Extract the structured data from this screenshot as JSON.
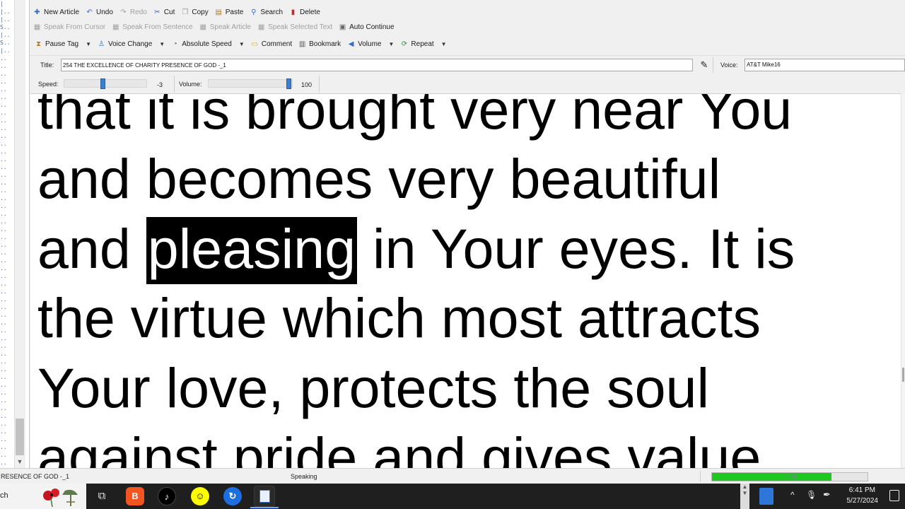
{
  "toolbar_main": {
    "new_article": "New Article",
    "undo": "Undo",
    "redo": "Redo",
    "cut": "Cut",
    "copy": "Copy",
    "paste": "Paste",
    "search": "Search",
    "delete": "Delete"
  },
  "toolbar_speak": {
    "speak_from_cursor": "Speak From Cursor",
    "speak_from_sentence": "Speak From Sentence",
    "speak_article": "Speak Article",
    "speak_selected_text": "Speak Selected Text",
    "auto_continue": "Auto Continue"
  },
  "toolbar_tags": {
    "pause_tag": "Pause Tag",
    "voice_change": "Voice Change",
    "absolute_speed": "Absolute Speed",
    "comment": "Comment",
    "bookmark": "Bookmark",
    "volume": "Volume",
    "repeat": "Repeat"
  },
  "title_row": {
    "label": "Title:",
    "value": "254 THE EXCELLENCE OF CHARITY PRESENCE OF GOD -_1",
    "voice_label": "Voice:",
    "voice_value": "AT&T Mike16"
  },
  "speed": {
    "label": "Speed:",
    "value": "-3",
    "level": 0.45
  },
  "volume": {
    "label": "Volume:",
    "value": "100",
    "level": 1.0
  },
  "document": {
    "lines": [
      {
        "text": "that it is brought very near You"
      },
      {
        "text": "and becomes very beautiful"
      },
      {
        "before": "and ",
        "highlight": "pleasing",
        "after": " in Your eyes. It is"
      },
      {
        "text": "the virtue which most attracts"
      },
      {
        "text": "Your love, protects the soul"
      },
      {
        "text": "against pride and gives value"
      }
    ]
  },
  "status": {
    "document_name": "RESENCE OF GOD -_1",
    "state": "Speaking",
    "progress_text": "77 %",
    "progress": 0.77
  },
  "taskbar": {
    "search_fragment": "ch",
    "time": "6:41 PM",
    "date": "5/27/2024"
  },
  "colors": {
    "highlight_bg": "#000000",
    "highlight_fg": "#ffffff",
    "progress_fill": "#1ec81e",
    "slider_thumb": "#3a7fd0",
    "taskbar_bg": "#1f1f1f"
  }
}
